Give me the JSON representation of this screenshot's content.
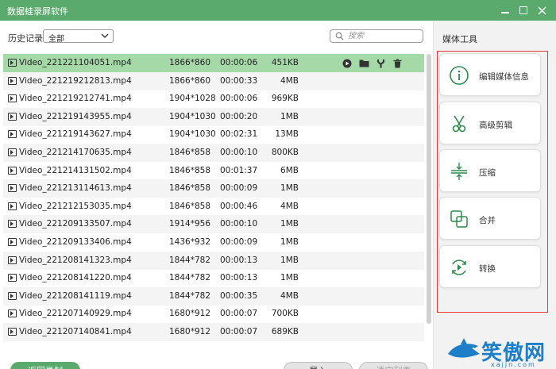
{
  "window": {
    "title": "数据蛙录屏软件"
  },
  "history": {
    "label": "历史记录",
    "filter_value": "全部"
  },
  "search": {
    "placeholder": "搜索"
  },
  "files": [
    {
      "name": "Video_221221104051.mp4",
      "resolution": "1866*860",
      "duration": "00:00:06",
      "size": "451KB"
    },
    {
      "name": "Video_221219212813.mp4",
      "resolution": "1866*860",
      "duration": "00:00:33",
      "size": "4MB"
    },
    {
      "name": "Video_221219212741.mp4",
      "resolution": "1904*1028",
      "duration": "00:00:06",
      "size": "969KB"
    },
    {
      "name": "Video_221219143955.mp4",
      "resolution": "1904*1030",
      "duration": "00:00:20",
      "size": "1MB"
    },
    {
      "name": "Video_221219143627.mp4",
      "resolution": "1904*1030",
      "duration": "00:02:31",
      "size": "13MB"
    },
    {
      "name": "Video_221214170635.mp4",
      "resolution": "1846*858",
      "duration": "00:00:10",
      "size": "800KB"
    },
    {
      "name": "Video_221214131502.mp4",
      "resolution": "1846*858",
      "duration": "00:01:37",
      "size": "6MB"
    },
    {
      "name": "Video_221213114613.mp4",
      "resolution": "1846*858",
      "duration": "00:00:09",
      "size": "1MB"
    },
    {
      "name": "Video_221212153035.mp4",
      "resolution": "1846*858",
      "duration": "00:00:46",
      "size": "4MB"
    },
    {
      "name": "Video_221209133507.mp4",
      "resolution": "1914*956",
      "duration": "00:00:10",
      "size": "1MB"
    },
    {
      "name": "Video_221209133406.mp4",
      "resolution": "1436*932",
      "duration": "00:00:09",
      "size": "1MB"
    },
    {
      "name": "Video_221208141323.mp4",
      "resolution": "1844*782",
      "duration": "00:00:13",
      "size": "1MB"
    },
    {
      "name": "Video_221208141220.mp4",
      "resolution": "1844*782",
      "duration": "00:00:13",
      "size": "1MB"
    },
    {
      "name": "Video_221208141119.mp4",
      "resolution": "1844*782",
      "duration": "00:00:35",
      "size": "4MB"
    },
    {
      "name": "Video_221207140929.mp4",
      "resolution": "1680*912",
      "duration": "00:00:07",
      "size": "700KB"
    },
    {
      "name": "Video_221207140841.mp4",
      "resolution": "1680*912",
      "duration": "00:00:07",
      "size": "689KB"
    }
  ],
  "selected_index": 0,
  "row_actions": [
    {
      "icon": "play-icon"
    },
    {
      "icon": "folder-icon"
    },
    {
      "icon": "edit-tool-icon"
    },
    {
      "icon": "trash-icon"
    }
  ],
  "buttons": {
    "back": "返回录制",
    "import": "导入",
    "clear": "清空列表"
  },
  "tools": {
    "title": "媒体工具",
    "items": [
      {
        "label": "编辑媒体信息",
        "icon": "info-icon"
      },
      {
        "label": "高级剪辑",
        "icon": "scissors-icon"
      },
      {
        "label": "压缩",
        "icon": "compress-icon"
      },
      {
        "label": "合并",
        "icon": "merge-icon"
      },
      {
        "label": "转换",
        "icon": "convert-icon"
      }
    ]
  },
  "watermark": {
    "text": "笑傲网",
    "sub": "xajjn.com"
  },
  "colors": {
    "accent": "#5aaa6e",
    "selected_row": "#a6d9a8",
    "highlight_frame": "#e03a3a",
    "watermark": "#1e7fc8"
  }
}
